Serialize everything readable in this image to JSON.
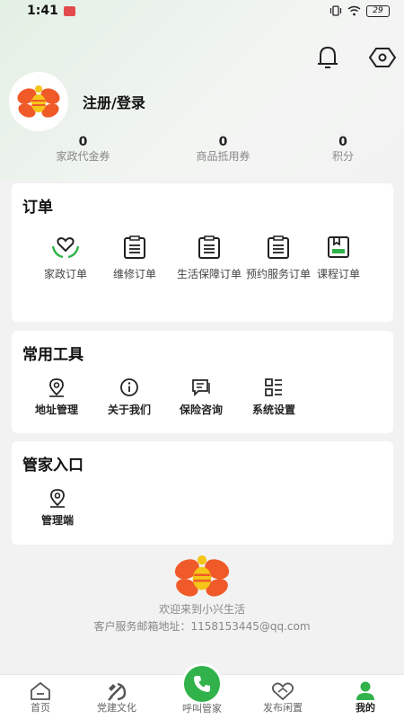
{
  "status_bar": {
    "time": "1:41",
    "battery": "29"
  },
  "header": {
    "icons": [
      "bell-icon",
      "hexagon-settings-icon"
    ]
  },
  "profile": {
    "login_label": "注册/登录"
  },
  "stats": [
    {
      "value": "0",
      "label": "家政代金券"
    },
    {
      "value": "0",
      "label": "商品抵用券"
    },
    {
      "value": "0",
      "label": "积分"
    }
  ],
  "orders": {
    "title": "订单",
    "items": [
      {
        "label": "家政订单",
        "icon": "housekeeping-heart-icon"
      },
      {
        "label": "维修订单",
        "icon": "clipboard-icon"
      },
      {
        "label": "生活保障订单",
        "icon": "clipboard-icon"
      },
      {
        "label": "预约服务订单",
        "icon": "clipboard-icon"
      },
      {
        "label": "课程订单",
        "icon": "course-book-icon"
      }
    ]
  },
  "tools": {
    "title": "常用工具",
    "items": [
      {
        "label": "地址管理",
        "icon": "location-pin-icon"
      },
      {
        "label": "关于我们",
        "icon": "info-icon"
      },
      {
        "label": "保险咨询",
        "icon": "chat-document-icon"
      },
      {
        "label": "系统设置",
        "icon": "settings-grid-icon"
      }
    ]
  },
  "butler": {
    "title": "管家入口",
    "items": [
      {
        "label": "管理端",
        "icon": "location-pin-icon"
      }
    ]
  },
  "footer": {
    "welcome": "欢迎来到小兴生活",
    "email": "客户服务邮箱地址：1158153445@qq.com"
  },
  "tabbar": {
    "items": [
      {
        "label": "首页",
        "icon": "home-icon"
      },
      {
        "label": "党建文化",
        "icon": "party-emblem-icon"
      },
      {
        "label": "呼叫管家",
        "icon": "phone-icon"
      },
      {
        "label": "发布闲置",
        "icon": "handshake-heart-icon"
      },
      {
        "label": "我的",
        "icon": "person-icon"
      }
    ],
    "active": "我的"
  },
  "colors": {
    "accent": "#31b24a",
    "logo_orange": "#f05a28",
    "logo_yellow": "#f5c518"
  }
}
